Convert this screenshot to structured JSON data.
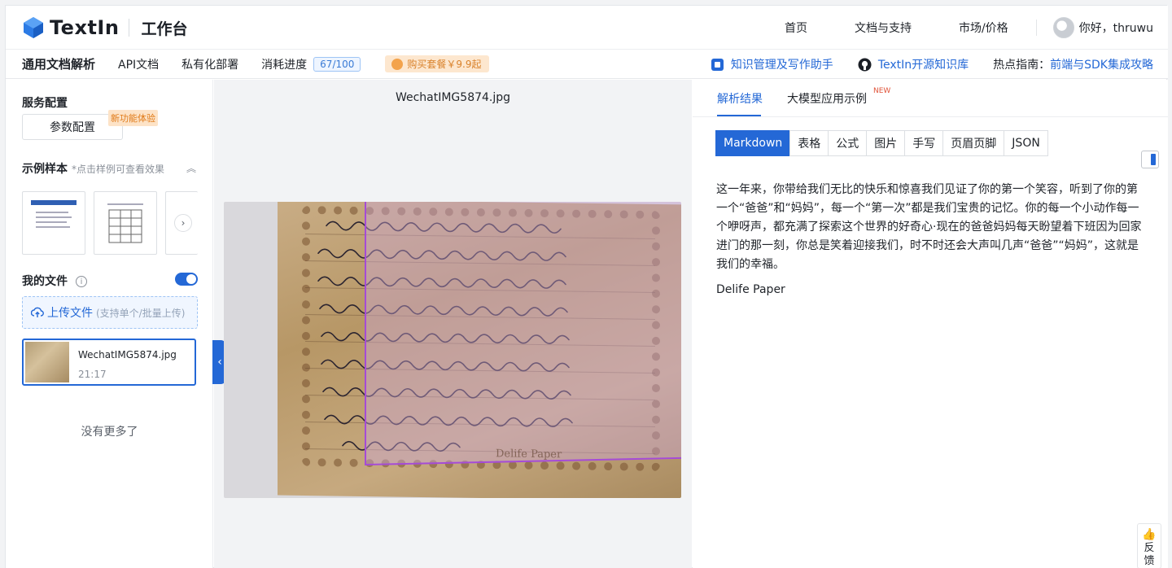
{
  "header": {
    "brand": "TextIn",
    "workspace": "工作台",
    "nav": [
      "首页",
      "文档与支持",
      "市场/价格"
    ],
    "greeting": "你好，thruwu"
  },
  "subbar": {
    "title": "通用文档解析",
    "items": [
      "API文档",
      "私有化部署"
    ],
    "usage_label": "消耗进度",
    "usage_value": "67/100",
    "buy_label": "购买套餐￥9.9起",
    "links": [
      "知识管理及写作助手",
      "TextIn开源知识库"
    ],
    "hot_label": "热点指南：",
    "hot_link": "前端与SDK集成攻略"
  },
  "left": {
    "service_config": "服务配置",
    "param_button": "参数配置",
    "new_feature_tag": "新功能体验",
    "samples_title": "示例样本",
    "samples_hint": "*点击样例可查看效果",
    "my_files": "我的文件",
    "upload_label": "上传文件",
    "upload_hint": "(支持单个/批量上传)",
    "file": {
      "name": "WechatIMG5874.jpg",
      "time": "21:17"
    },
    "no_more": "没有更多了"
  },
  "viewer": {
    "filename": "WechatIMG5874.jpg",
    "paper_brand": "Delife Paper"
  },
  "right": {
    "tabs": [
      "解析结果",
      "大模型应用示例"
    ],
    "new_badge": "NEW",
    "formats": [
      "Markdown",
      "表格",
      "公式",
      "图片",
      "手写",
      "页眉页脚",
      "JSON"
    ],
    "result_paragraph": "这一年来，你带给我们无比的快乐和惊喜我们见证了你的第一个笑容，听到了你的第一个“爸爸”和“妈妈”，每一个“第一次”都是我们宝贵的记忆。你的每一个小动作每一个咿呀声，都充满了探索这个世界的好奇心·现在的爸爸妈妈每天盼望着下班因为回家进门的那一刻，你总是笑着迎接我们，时不时还会大声叫几声“爸爸”“妈妈”，这就是我们的幸福。",
    "result_footer": "Delife Paper",
    "feedback": "反馈"
  },
  "colors": {
    "accent": "#2468d6",
    "overlay": "#a54bd6",
    "buy": "#d9822b"
  }
}
